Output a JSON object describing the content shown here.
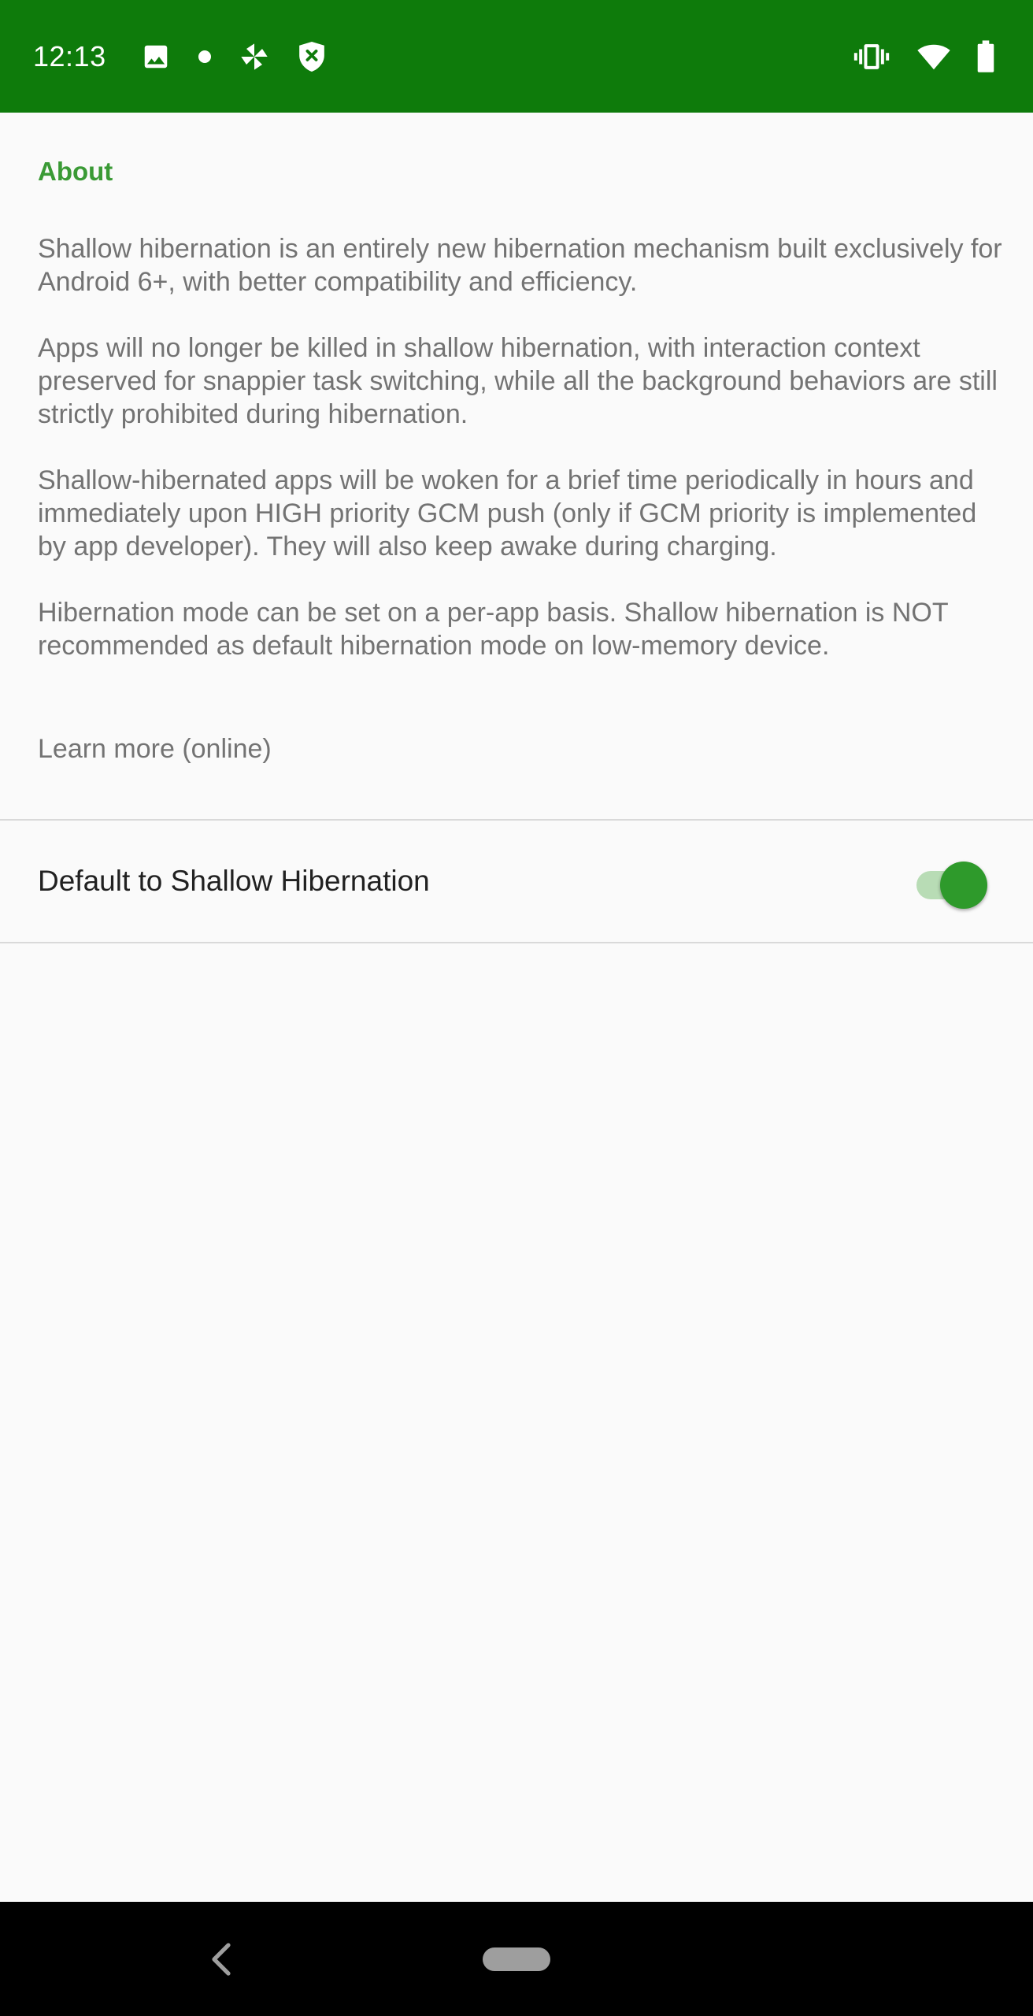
{
  "status_bar": {
    "time": "12:13",
    "background": "#0e7b0b",
    "left_icons": [
      "image-icon",
      "dot-icon",
      "pinwheel-icon",
      "shield-x-icon"
    ],
    "right_icons": [
      "vibrate-icon",
      "wifi-icon",
      "battery-icon"
    ]
  },
  "about": {
    "title": "About",
    "paragraphs": [
      "Shallow hibernation is an entirely new hibernation mechanism built exclusively for Android 6+, with better compatibility and efficiency.",
      "Apps will no longer be killed in shallow hibernation, with interaction context preserved for snappier task switching, while all the background behaviors are still strictly prohibited during hibernation.",
      "Shallow-hibernated apps will be woken for a brief time periodically in hours and immediately upon HIGH priority GCM push (only if GCM priority is implemented by app developer). They will also keep awake during charging.",
      "Hibernation mode can be set on a per-app basis. Shallow hibernation is NOT recommended as default hibernation mode on low-memory device."
    ],
    "learn_more": "Learn more (online)"
  },
  "preference": {
    "title": "Default to Shallow Hibernation",
    "enabled": true
  },
  "colors": {
    "accent": "#3a9a35",
    "switch_thumb": "#2e9a2b",
    "switch_track": "#b8dcb5"
  },
  "nav_bar": {
    "icons": [
      "back-icon",
      "home-pill-icon"
    ]
  }
}
